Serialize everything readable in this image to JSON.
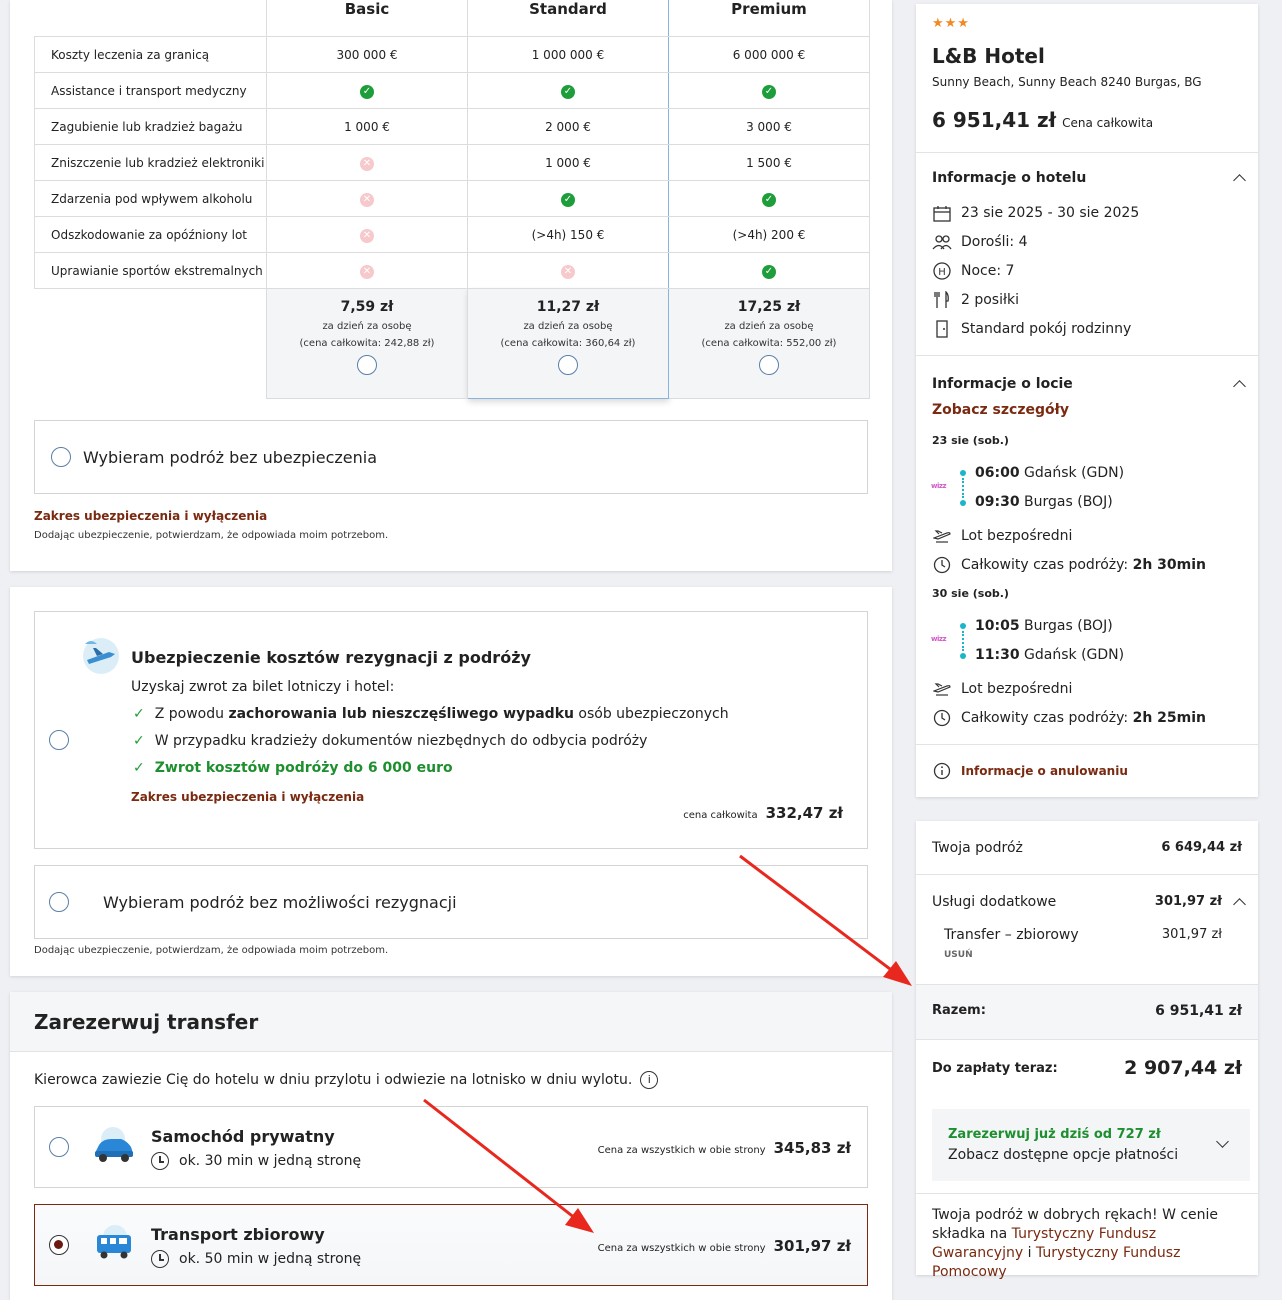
{
  "insurance": {
    "plans": [
      {
        "name": "Basic",
        "price": "7,59 zł",
        "per": "za dzień za osobę",
        "total": "(cena całkowita: 242,88 zł)"
      },
      {
        "name": "Standard",
        "price": "11,27 zł",
        "per": "za dzień za osobę",
        "total": "(cena całkowita: 360,64 zł)"
      },
      {
        "name": "Premium",
        "price": "17,25 zł",
        "per": "za dzień za osobę",
        "total": "(cena całkowita: 552,00 zł)"
      }
    ],
    "rows": [
      {
        "label": "Koszty leczenia za granicą",
        "basic": "300 000 €",
        "standard": "1 000 000 €",
        "premium": "6 000 000 €"
      },
      {
        "label": "Assistance i transport medyczny",
        "basic": "ok",
        "standard": "ok",
        "premium": "ok"
      },
      {
        "label": "Zagubienie lub kradzież bagażu",
        "basic": "1 000 €",
        "standard": "2 000 €",
        "premium": "3 000 €"
      },
      {
        "label": "Zniszczenie lub kradzież elektroniki",
        "basic": "no",
        "standard": "1 000 €",
        "premium": "1 500 €"
      },
      {
        "label": "Zdarzenia pod wpływem alkoholu",
        "basic": "no",
        "standard": "ok",
        "premium": "ok"
      },
      {
        "label": "Odszkodowanie za opóźniony lot",
        "basic": "no",
        "standard": "(>4h) 150 €",
        "premium": "(>4h) 200 €"
      },
      {
        "label": "Uprawianie sportów ekstremalnych",
        "basic": "no",
        "standard": "no",
        "premium": "ok"
      }
    ],
    "no_insurance_label": "Wybieram podróż bez ubezpieczenia",
    "scope_link": "Zakres ubezpieczenia i wyłączenia",
    "consent_note": "Dodając ubezpieczenie, potwierdzam, że odpowiada moim potrzebom."
  },
  "cancellation": {
    "title": "Ubezpieczenie kosztów rezygnacji z podróży",
    "intro": "Uzyskaj zwrot za bilet lotniczy i hotel:",
    "b1_pre": "Z powodu ",
    "b1_bold": "zachorowania lub nieszczęśliwego wypadku",
    "b1_post": " osób ubezpieczonych",
    "b2": "W przypadku kradzieży dokumentów niezbędnych do odbycia podróży",
    "b3": "Zwrot kosztów podróży do 6 000 euro",
    "scope_link": "Zakres ubezpieczenia i wyłączenia",
    "price_label": "cena całkowita",
    "price": "332,47 zł",
    "no_cancel_label": "Wybieram podróż bez możliwości rezygnacji",
    "consent_note": "Dodając ubezpieczenie, potwierdzam, że odpowiada moim potrzebom."
  },
  "transfer": {
    "title": "Zarezerwuj transfer",
    "desc": "Kierowca zawiezie Cię do hotelu w dniu przylotu i odwiezie na lotnisko w dniu wylotu.",
    "options": [
      {
        "name": "Samochód prywatny",
        "duration": "ok. 30 min w jedną stronę",
        "price_label": "Cena za wszystkich w obie strony",
        "price": "345,83 zł"
      },
      {
        "name": "Transport zbiorowy",
        "duration": "ok. 50 min w jedną stronę",
        "price_label": "Cena za wszystkich w obie strony",
        "price": "301,97 zł"
      }
    ]
  },
  "hotel": {
    "stars": "★★★",
    "name": "L&B Hotel",
    "address": "Sunny Beach, Sunny Beach 8240 Burgas, BG",
    "price": "6 951,41 zł",
    "price_label": "Cena całkowita",
    "info_title": "Informacje o hotelu",
    "dates": "23 sie 2025 - 30 sie 2025",
    "adults": "Dorośli: 4",
    "nights": "Noce: 7",
    "meals": "2 posiłki",
    "room": "Standard pokój rodzinny",
    "flight_title": "Informacje o locie",
    "details_link": "Zobacz szczegóły",
    "out_date": "23 sie (sob.)",
    "out_dep_time": "06:00",
    "out_dep_place": " Gdańsk (GDN)",
    "out_arr_time": "09:30",
    "out_arr_place": " Burgas (BOJ)",
    "direct": "Lot bezpośredni",
    "total_time_label": "Całkowity czas podróży: ",
    "out_total": "2h 30min",
    "ret_date": "30 sie (sob.)",
    "ret_dep_time": "10:05",
    "ret_dep_place": " Burgas (BOJ)",
    "ret_arr_time": "11:30",
    "ret_arr_place": " Gdańsk (GDN)",
    "ret_total": "2h 25min",
    "airline": "wizz",
    "cancel_info": "Informacje o anulowaniu"
  },
  "summary": {
    "trip_label": "Twoja podróż",
    "trip_value": "6 649,44 zł",
    "extras_label": "Usługi dodatkowe",
    "extras_value": "301,97 zł",
    "transfer_label": "Transfer – zbiorowy",
    "transfer_value": "301,97 zł",
    "remove": "USUŃ",
    "total_label": "Razem:",
    "total_value": "6 951,41 zł",
    "pay_now_label": "Do zapłaty teraz:",
    "pay_now_value": "2 907,44 zł",
    "book_today": "Zarezerwuj już dziś od 727 zł",
    "see_options": "Zobacz dostępne opcje płatności",
    "trust_pre": "Twoja podróż w dobrych rękach! W cenie składka na ",
    "fund1": "Turystyczny Fundusz Gwarancyjny",
    "trust_mid": " i ",
    "fund2": "Turystyczny Fundusz Pomocowy"
  },
  "colors": {
    "accent_red": "#7a2a10",
    "green": "#1e9e3a",
    "arrow": "#e8281e"
  }
}
